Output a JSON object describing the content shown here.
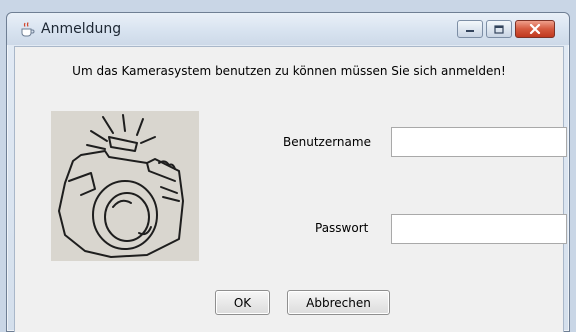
{
  "window": {
    "title": "Anmeldung",
    "icon": "java-cup-icon"
  },
  "dialog": {
    "message": "Um das Kamerasystem benutzen zu können müssen Sie sich anmelden!",
    "image": "camera-illustration",
    "username_label": "Benutzername",
    "username_value": "",
    "password_label": "Passwort",
    "password_value": "",
    "ok_label": "OK",
    "cancel_label": "Abbrechen"
  },
  "colors": {
    "titlebar": "#d8e3f0",
    "close_button": "#c0391f",
    "client_background": "#f0f0f0"
  }
}
